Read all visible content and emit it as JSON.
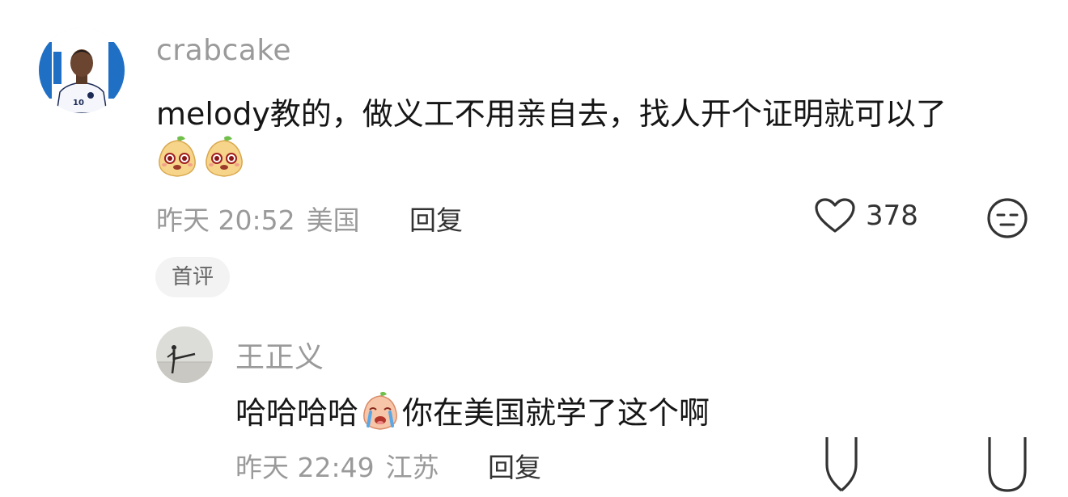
{
  "comment": {
    "username": "crabcake",
    "text": "melody教的，做义工不用亲自去，找人开个证明就可以了",
    "emojis": [
      "pear-mascot-emoji",
      "pear-mascot-emoji"
    ],
    "time": "昨天 20:52",
    "location": "美国",
    "reply_label": "回复",
    "like_count": "378",
    "badge": "首评"
  },
  "reply": {
    "username": "王正义",
    "text_before": "哈哈哈哈",
    "emoji": "crying-pear-emoji",
    "text_after": "你在美国就学了这个啊",
    "time": "昨天 22:49",
    "location": "江苏",
    "reply_label": "回复"
  },
  "colors": {
    "meta_gray": "#9a9a9a",
    "text_dark": "#161616",
    "badge_bg": "#f3f3f3"
  }
}
